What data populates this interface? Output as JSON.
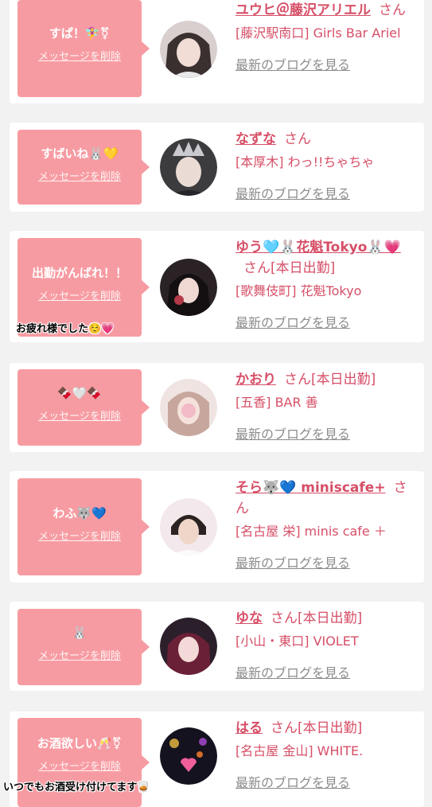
{
  "delete_label": "メッセージを削除",
  "blog_label": "最新のブログを見る",
  "san_label": "さん",
  "entries": [
    {
      "message": "すぱ！🧚‍♀️⚧",
      "name": "ユウヒ＠藤沢アリエル",
      "san": "さん",
      "shop": "[藤沢駅南口] Girls Bar Ariel"
    },
    {
      "message": "すばいね🐰💛",
      "name": "なずな",
      "san": "さん",
      "shop": "[本厚木] わっ!!ちゃちゃ"
    },
    {
      "message": "出勤がんばれ！！",
      "name": "ゆう🩵🐰花魁Tokyo🐰💗",
      "san": "さん[本日出勤]",
      "shop": "[歌舞伎町] 花魁Tokyo",
      "overlay": "お疲れ様でした☺️💗"
    },
    {
      "message": "🍫🤍🍫",
      "name": "かおり",
      "san": "さん[本日出勤]",
      "shop": "[五香] BAR 善"
    },
    {
      "message": "わふ🐺💙",
      "name": "そら🐺💙 miniscafe+",
      "san": "さん",
      "shop": "[名古屋 栄] minis cafe ＋"
    },
    {
      "message": "🐰",
      "name": "ゆな",
      "san": "さん[本日出勤]",
      "shop": "[小山・東口] VIOLET"
    },
    {
      "message": "お酒欲しい🥂⚧",
      "name": "はる",
      "san": "さん[本日出勤]",
      "shop": "[名古屋 金山] WHITE.",
      "overlay": "いつでもお酒受け付けてます🥃"
    }
  ],
  "colors": {
    "bubble": "#f79ba2",
    "name": "#d64f67",
    "link": "#8c8c8c"
  }
}
